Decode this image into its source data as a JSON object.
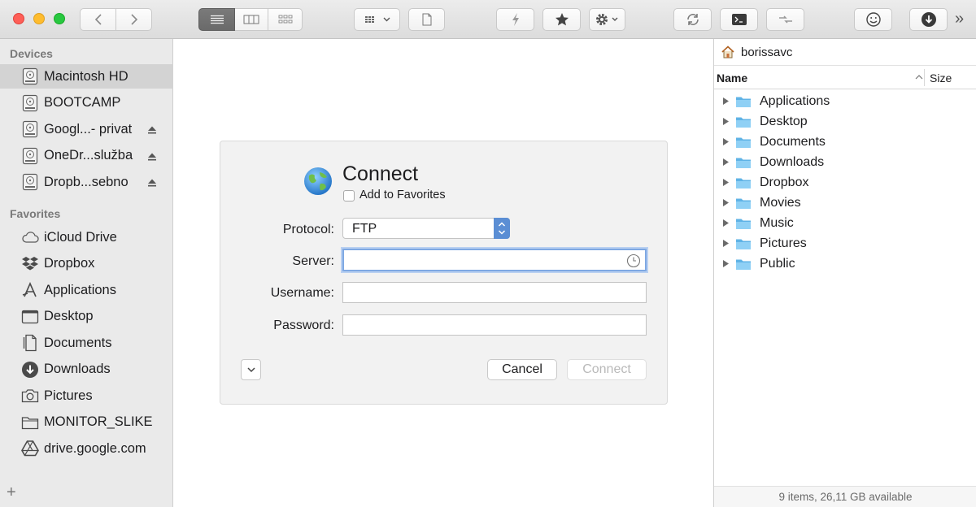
{
  "colors": {
    "accent": "#6b9ed9",
    "close": "#fe5f57",
    "minimize": "#febc2e",
    "zoom": "#28c840",
    "folder": "#5fb3e6"
  },
  "toolbar": {
    "icons": [
      "back-icon",
      "forward-icon",
      "list-view-icon",
      "column-view-icon",
      "icon-view-icon",
      "grid-menu-icon",
      "new-file-icon",
      "lightning-icon",
      "star-icon",
      "gear-icon",
      "sync-icon",
      "terminal-icon",
      "compare-icon",
      "smiley-icon",
      "download-icon",
      "overflow-icon"
    ],
    "overflow_label": "»"
  },
  "sidebar": {
    "devices_header": "Devices",
    "favorites_header": "Favorites",
    "devices": [
      {
        "label": "Macintosh HD",
        "icon": "hard-drive-icon",
        "selected": true,
        "ejectable": false
      },
      {
        "label": "BOOTCAMP",
        "icon": "hard-drive-icon",
        "selected": false,
        "ejectable": false
      },
      {
        "label": "Googl...- privat",
        "icon": "hard-drive-icon",
        "selected": false,
        "ejectable": true
      },
      {
        "label": "OneDr...služba",
        "icon": "hard-drive-icon",
        "selected": false,
        "ejectable": true
      },
      {
        "label": "Dropb...sebno",
        "icon": "hard-drive-icon",
        "selected": false,
        "ejectable": true
      }
    ],
    "favorites": [
      {
        "label": "iCloud Drive",
        "icon": "cloud-icon"
      },
      {
        "label": "Dropbox",
        "icon": "dropbox-icon"
      },
      {
        "label": "Applications",
        "icon": "applications-icon"
      },
      {
        "label": "Desktop",
        "icon": "desktop-icon"
      },
      {
        "label": "Documents",
        "icon": "documents-icon"
      },
      {
        "label": "Downloads",
        "icon": "downloads-icon"
      },
      {
        "label": "Pictures",
        "icon": "camera-icon"
      },
      {
        "label": "MONITOR_SLIKE",
        "icon": "folder-icon"
      },
      {
        "label": "drive.google.com",
        "icon": "google-drive-icon"
      }
    ],
    "add_label": "+"
  },
  "dialog": {
    "title": "Connect",
    "favorites_label": "Add to Favorites",
    "favorites_checked": false,
    "protocol_label": "Protocol:",
    "protocol_value": "FTP",
    "server_label": "Server:",
    "server_value": "",
    "username_label": "Username:",
    "username_value": "",
    "password_label": "Password:",
    "password_value": "",
    "cancel_label": "Cancel",
    "connect_label": "Connect"
  },
  "right_panel": {
    "path": "borissavc",
    "columns": {
      "name": "Name",
      "size": "Size"
    },
    "items": [
      "Applications",
      "Desktop",
      "Documents",
      "Downloads",
      "Dropbox",
      "Movies",
      "Music",
      "Pictures",
      "Public"
    ],
    "status": "9 items, 26,11 GB available"
  }
}
